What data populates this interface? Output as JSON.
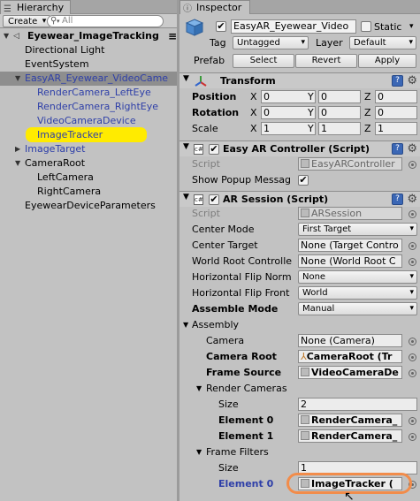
{
  "hierarchy": {
    "tab_label": "Hierarchy",
    "create_label": "Create",
    "search_placeholder": "All",
    "scene_name": "Eyewear_ImageTracking",
    "items": [
      {
        "label": "Directional Light"
      },
      {
        "label": "EventSystem"
      },
      {
        "label": "EasyAR_Eyewear_VideoCame"
      },
      {
        "label": "RenderCamera_LeftEye"
      },
      {
        "label": "RenderCamera_RightEye"
      },
      {
        "label": "VideoCameraDevice"
      },
      {
        "label": "ImageTracker"
      },
      {
        "label": "ImageTarget"
      },
      {
        "label": "CameraRoot"
      },
      {
        "label": "LeftCamera"
      },
      {
        "label": "RightCamera"
      },
      {
        "label": "EyewearDeviceParameters"
      }
    ]
  },
  "inspector": {
    "tab_label": "Inspector",
    "object_name": "EasyAR_Eyewear_Video",
    "static_label": "Static",
    "tag_label": "Tag",
    "tag_value": "Untagged",
    "layer_label": "Layer",
    "layer_value": "Default",
    "prefab_label": "Prefab",
    "select_label": "Select",
    "revert_label": "Revert",
    "apply_label": "Apply",
    "transform": {
      "title": "Transform",
      "position_label": "Position",
      "rotation_label": "Rotation",
      "scale_label": "Scale",
      "axis_x": "X",
      "axis_y": "Y",
      "axis_z": "Z",
      "position": [
        "0",
        "0",
        "0"
      ],
      "rotation": [
        "0",
        "0",
        "0"
      ],
      "scale": [
        "1",
        "1",
        "1"
      ]
    },
    "controller": {
      "title": "Easy AR Controller (Script)",
      "script_label": "Script",
      "script_value": "EasyARController",
      "popup_label": "Show Popup Messag"
    },
    "session": {
      "title": "AR Session (Script)",
      "script_label": "Script",
      "script_value": "ARSession",
      "center_mode_label": "Center Mode",
      "center_mode_value": "First Target",
      "center_target_label": "Center Target",
      "center_target_value": "None (Target Contro",
      "world_root_label": "World Root Controlle",
      "world_root_value": "None (World Root C",
      "hflip_normal_label": "Horizontal Flip Norm",
      "hflip_normal_value": "None",
      "hflip_front_label": "Horizontal Flip Front",
      "hflip_front_value": "World",
      "assemble_mode_label": "Assemble Mode",
      "assemble_mode_value": "Manual",
      "assembly_label": "Assembly",
      "camera_label": "Camera",
      "camera_value": "None (Camera)",
      "camera_root_label": "Camera Root",
      "camera_root_value": "CameraRoot (Tr",
      "frame_source_label": "Frame Source",
      "frame_source_value": "VideoCameraDe",
      "render_cameras_label": "Render Cameras",
      "rc_size_label": "Size",
      "rc_size_value": "2",
      "element0_label": "Element 0",
      "element0_value": "RenderCamera_",
      "element1_label": "Element 1",
      "element1_value": "RenderCamera_",
      "frame_filters_label": "Frame Filters",
      "ff_size_label": "Size",
      "ff_size_value": "1",
      "ff_element0_label": "Element 0",
      "ff_element0_value": "ImageTracker ("
    }
  }
}
